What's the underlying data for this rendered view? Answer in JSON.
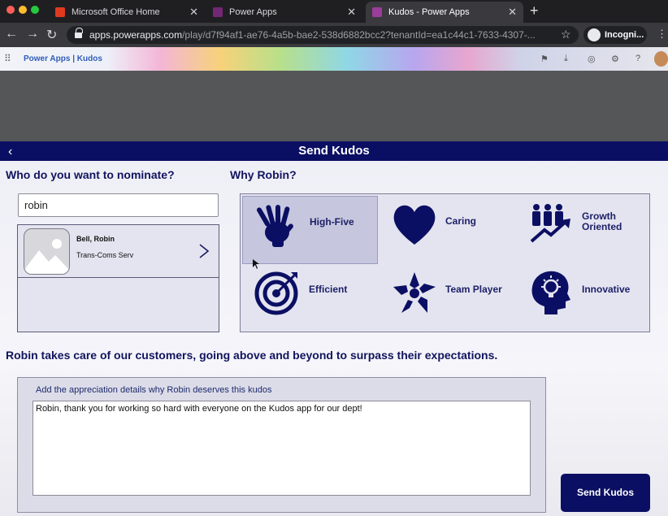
{
  "browser": {
    "tabs": [
      {
        "title": "Microsoft Office Home",
        "icon": "office-icon",
        "active": false
      },
      {
        "title": "Power Apps",
        "icon": "powerapps-icon",
        "active": false
      },
      {
        "title": "Kudos - Power Apps",
        "icon": "powerapps-icon",
        "active": true
      }
    ],
    "url_host": "apps.powerapps.com",
    "url_path": "/play/d7f94af1-ae76-4a5b-bae2-538d6882bcc2?tenantId=ea1c44c1-7633-4307-...",
    "incognito_label": "Incogni..."
  },
  "app_header": {
    "breadcrumb": "Power Apps  |  Kudos"
  },
  "app": {
    "title": "Send Kudos",
    "nominate_heading": "Who do you want to nominate?",
    "search_value": "robin",
    "gallery": [
      {
        "name": "Bell, Robin",
        "department": "Trans-Coms Serv"
      }
    ],
    "why_heading": "Why Robin?",
    "badges": [
      {
        "label": "High-Five",
        "icon": "high-five-icon",
        "selected": true
      },
      {
        "label": "Caring",
        "icon": "heart-icon",
        "selected": false
      },
      {
        "label": "Growth Oriented",
        "icon": "growth-icon",
        "selected": false
      },
      {
        "label": "Efficient",
        "icon": "target-icon",
        "selected": false
      },
      {
        "label": "Team Player",
        "icon": "team-icon",
        "selected": false
      },
      {
        "label": "Innovative",
        "icon": "idea-head-icon",
        "selected": false
      }
    ],
    "statement": "Robin takes care of our customers, going above and beyond to surpass their expectations.",
    "details_hint": "Add the appreciation details why Robin deserves this kudos",
    "details_value": "Robin, thank you for working so hard with everyone on the Kudos app for our dept!",
    "send_label": "Send Kudos"
  },
  "colors": {
    "navy": "#0b0f63",
    "panel": "#e4e4f0",
    "selected_card": "#c6c7de"
  }
}
